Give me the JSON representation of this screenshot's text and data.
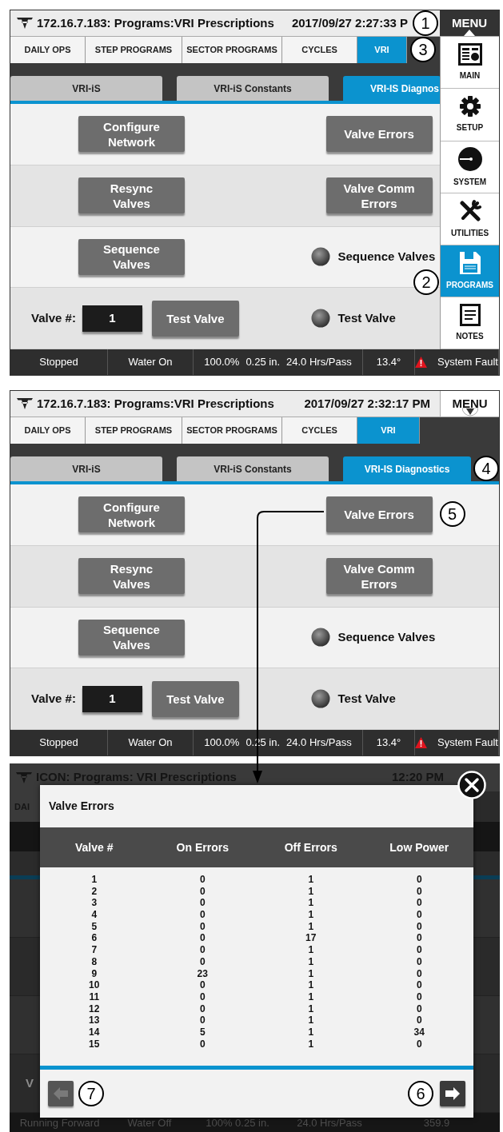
{
  "screens": [
    {
      "title": "172.16.7.183: Programs:VRI Prescriptions",
      "datetime": "2017/09/27 2:27:33 P",
      "menu": {
        "label": "MENU",
        "expanded": true,
        "callout": "1",
        "items": [
          {
            "label": "MAIN",
            "selected": false
          },
          {
            "label": "SETUP",
            "selected": false
          },
          {
            "label": "SYSTEM",
            "selected": false
          },
          {
            "label": "UTILITIES",
            "selected": false
          },
          {
            "label": "PROGRAMS",
            "selected": true,
            "callout": "2"
          },
          {
            "label": "NOTES",
            "selected": false
          }
        ]
      },
      "tabs": [
        {
          "label": "DAILY OPS",
          "selected": false
        },
        {
          "label": "STEP PROGRAMS",
          "selected": false
        },
        {
          "label": "SECTOR PROGRAMS",
          "selected": false
        },
        {
          "label": "CYCLES",
          "selected": false
        },
        {
          "label": "VRI",
          "selected": true,
          "callout": "3"
        }
      ],
      "subtabs": [
        {
          "label": "VRI-iS",
          "selected": false
        },
        {
          "label": "VRI-iS Constants",
          "selected": false
        },
        {
          "label": "VRI-IS Diagnos",
          "selected": true
        }
      ],
      "rows": [
        {
          "left": {
            "kind": "button",
            "label": "Configure Network"
          },
          "right": {
            "kind": "button",
            "label": "Valve Errors"
          }
        },
        {
          "left": {
            "kind": "button",
            "label": "Resync Valves"
          },
          "right": {
            "kind": "button",
            "label": "Valve Comm Errors"
          }
        },
        {
          "left": {
            "kind": "button",
            "label": "Sequence Valves"
          },
          "right": {
            "kind": "indicator",
            "label": "Sequence Valves",
            "on": false
          }
        },
        {
          "left": {
            "kind": "valve_input",
            "label": "Valve #:",
            "value": "1",
            "button": "Test Valve"
          },
          "right": {
            "kind": "indicator",
            "label": "Test Valve",
            "on": false
          }
        }
      ],
      "status": [
        {
          "kind": "plain",
          "parts": [
            "Stopped"
          ]
        },
        {
          "kind": "plain",
          "parts": [
            "Water On"
          ]
        },
        {
          "kind": "plain",
          "parts": [
            "100.0%",
            "0.25 in.",
            "24.0 Hrs/Pass"
          ]
        },
        {
          "kind": "plain",
          "parts": [
            "13.4°"
          ]
        },
        {
          "kind": "fault",
          "parts": [
            "System Fault"
          ]
        }
      ]
    },
    {
      "title": "172.16.7.183: Programs:VRI Prescriptions",
      "datetime": "2017/09/27 2:32:17 PM",
      "menu": {
        "label": "MENU",
        "expanded": false
      },
      "tabs": [
        {
          "label": "DAILY OPS",
          "selected": false
        },
        {
          "label": "STEP PROGRAMS",
          "selected": false
        },
        {
          "label": "SECTOR PROGRAMS",
          "selected": false
        },
        {
          "label": "CYCLES",
          "selected": false
        },
        {
          "label": "VRI",
          "selected": true
        }
      ],
      "subtabs": [
        {
          "label": "VRI-iS",
          "selected": false
        },
        {
          "label": "VRI-iS Constants",
          "selected": false
        },
        {
          "label": "VRI-IS Diagnostics",
          "selected": true,
          "callout": "4"
        }
      ],
      "rows": [
        {
          "left": {
            "kind": "button",
            "label": "Configure Network"
          },
          "right": {
            "kind": "button",
            "label": "Valve Errors",
            "callout": "5"
          }
        },
        {
          "left": {
            "kind": "button",
            "label": "Resync Valves"
          },
          "right": {
            "kind": "button",
            "label": "Valve Comm Errors"
          }
        },
        {
          "left": {
            "kind": "button",
            "label": "Sequence Valves"
          },
          "right": {
            "kind": "indicator",
            "label": "Sequence Valves",
            "on": false
          }
        },
        {
          "left": {
            "kind": "valve_input",
            "label": "Valve #:",
            "value": "1",
            "button": "Test Valve"
          },
          "right": {
            "kind": "indicator",
            "label": "Test Valve",
            "on": false
          }
        }
      ],
      "status": [
        {
          "kind": "plain",
          "parts": [
            "Stopped"
          ]
        },
        {
          "kind": "plain",
          "parts": [
            "Water On"
          ]
        },
        {
          "kind": "plain",
          "parts": [
            "100.0%",
            "0.25 in.",
            "24.0 Hrs/Pass"
          ]
        },
        {
          "kind": "plain",
          "parts": [
            "13.4°"
          ]
        },
        {
          "kind": "fault",
          "parts": [
            "System Fault"
          ]
        }
      ]
    }
  ],
  "dialog_screen": {
    "background": {
      "title": "ICON: Programs: VRI Prescriptions",
      "time": "12:20 PM",
      "tab": "DAI",
      "row_label": "V",
      "status": [
        "Running Forward",
        "Water Off",
        "100% 0.25 in.",
        "24.0 Hrs/Pass",
        "359.9"
      ]
    },
    "modal": {
      "title": "Valve Errors",
      "columns": [
        "Valve #",
        "On Errors",
        "Off Errors",
        "Low Power"
      ],
      "rows": [
        [
          "1",
          "0",
          "1",
          "0"
        ],
        [
          "2",
          "0",
          "1",
          "0"
        ],
        [
          "3",
          "0",
          "1",
          "0"
        ],
        [
          "4",
          "0",
          "1",
          "0"
        ],
        [
          "5",
          "0",
          "1",
          "0"
        ],
        [
          "6",
          "0",
          "17",
          "0"
        ],
        [
          "7",
          "0",
          "1",
          "0"
        ],
        [
          "8",
          "0",
          "1",
          "0"
        ],
        [
          "9",
          "23",
          "1",
          "0"
        ],
        [
          "10",
          "0",
          "1",
          "0"
        ],
        [
          "11",
          "0",
          "1",
          "0"
        ],
        [
          "12",
          "0",
          "1",
          "0"
        ],
        [
          "13",
          "0",
          "1",
          "0"
        ],
        [
          "14",
          "5",
          "1",
          "34"
        ],
        [
          "15",
          "0",
          "1",
          "0"
        ]
      ],
      "prev": {
        "disabled": true,
        "callout": "7"
      },
      "next": {
        "disabled": false,
        "callout": "6"
      }
    }
  }
}
